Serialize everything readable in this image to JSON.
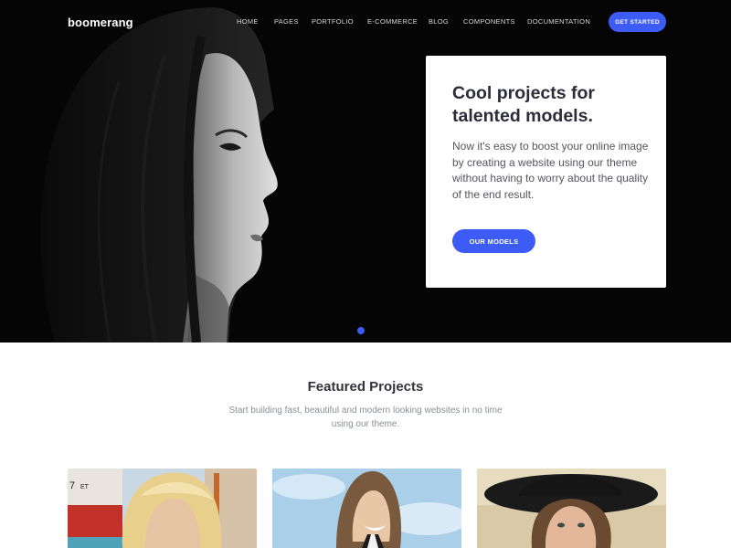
{
  "brand": {
    "logo": "boomerang"
  },
  "nav": {
    "items": [
      {
        "label": "HOME"
      },
      {
        "label": "PAGES"
      },
      {
        "label": "PORTFOLIO"
      },
      {
        "label": "E-COMMERCE"
      },
      {
        "label": "BLOG"
      },
      {
        "label": "COMPONENTS"
      },
      {
        "label": "DOCUMENTATION"
      }
    ],
    "cta_label": "GET STARTED"
  },
  "hero": {
    "title": "Cool projects for talented models.",
    "text": "Now it's easy to boost your online image by creating a website using our theme without having to worry about the quality of the end result.",
    "button_label": "OUR MODELS",
    "slide_count": 1,
    "active_slide": 1
  },
  "featured": {
    "title": "Featured Projects",
    "subtitle": "Start building fast, beautiful and modern looking websites in no time using our theme.",
    "projects": [
      {
        "image": "blonde-woman-photo"
      },
      {
        "image": "laughing-woman-photo"
      },
      {
        "image": "woman-in-hat-photo"
      }
    ]
  },
  "colors": {
    "accent": "#3d5bf5",
    "hero_background": "#050505",
    "heading": "#2c2c3a",
    "muted_text": "#8a8f98"
  }
}
